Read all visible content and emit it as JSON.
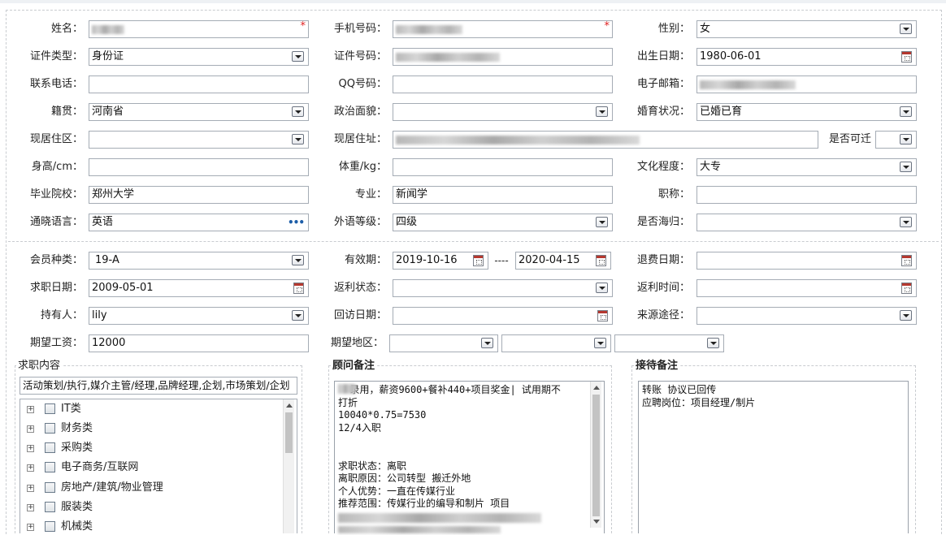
{
  "basic": {
    "name_label": "姓名：",
    "phone_label": "手机号码：",
    "gender_label": "性别：",
    "gender_value": "女",
    "idtype_label": "证件类型：",
    "idtype_value": "身份证",
    "idno_label": "证件号码：",
    "birth_label": "出生日期：",
    "birth_value": "1980-06-01",
    "contact_label": "联系电话：",
    "qq_label": "QQ号码：",
    "email_label": "电子邮箱：",
    "native_label": "籍贯：",
    "native_value": "河南省",
    "political_label": "政治面貌：",
    "marital_label": "婚育状况：",
    "marital_value": "已婚已育",
    "district_label": "现居住区：",
    "address_label": "现居住址：",
    "relocate_label": "是否可迁",
    "height_label": "身高/cm：",
    "weight_label": "体重/kg：",
    "education_label": "文化程度：",
    "education_value": "大专",
    "school_label": "毕业院校：",
    "school_value": "郑州大学",
    "major_label": "专业：",
    "major_value": "新闻学",
    "title_label": "职称：",
    "language_label": "通晓语言：",
    "language_value": "英语",
    "langlevel_label": "外语等级：",
    "langlevel_value": "四级",
    "overseas_label": "是否海归："
  },
  "membership": {
    "type_label": "会员种类：",
    "type_value": "19-A",
    "valid_label": "有效期：",
    "valid_from": "2019-10-16",
    "valid_sep": "----",
    "valid_to": "2020-04-15",
    "refund_date_label": "退费日期：",
    "job_date_label": "求职日期：",
    "job_date_value": "2009-05-01",
    "rebate_status_label": "返利状态：",
    "rebate_time_label": "返利时间：",
    "holder_label": "持有人：",
    "holder_value": "lily",
    "revisit_label": "回访日期：",
    "source_label": "来源途径：",
    "salary_label": "期望工资：",
    "salary_value": "12000",
    "area_label": "期望地区："
  },
  "job_content": {
    "title": "求职内容",
    "selected_text": "活动策划/执行,媒介主管/经理,品牌经理,企划,市场策划/企划",
    "tree": [
      "IT类",
      "财务类",
      "采购类",
      "电子商务/互联网",
      "房地产/建筑/物业管理",
      "服装类",
      "机械类"
    ]
  },
  "consultant_note": {
    "title": "顾问备注",
    "text": "  录用，薪资9600+餐补440+项目奖金| 试用期不\n打折\n10040*0.75=7530\n12/4入职\n\n\n求职状态：离职\n离职原因：公司转型 搬迁外地\n个人优势：一直在传媒行业\n推荐范围：传媒行业的编导和制片 项目"
  },
  "reception_note": {
    "title": "接待备注",
    "text": "转账 协议已回传\n应聘岗位：项目经理/制片"
  }
}
